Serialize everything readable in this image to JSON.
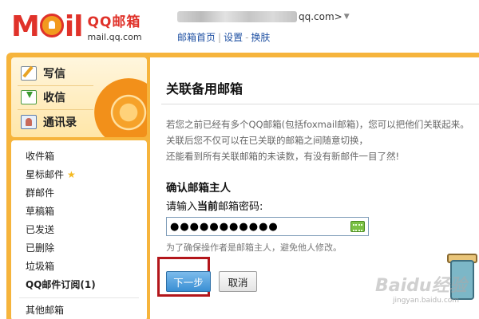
{
  "header": {
    "logo_brand": "Mil",
    "logo_cn": "QQ邮箱",
    "logo_url": "mail.qq.com",
    "account_suffix": "qq.com>",
    "links": [
      "邮箱首页",
      "设置",
      "换肤"
    ],
    "link_separators": [
      "|",
      "-"
    ]
  },
  "sidebar": {
    "quick_actions": [
      "写信",
      "收信",
      "通讯录"
    ],
    "folders": [
      "收件箱",
      "星标邮件",
      "群邮件",
      "草稿箱",
      "已发送",
      "已删除",
      "垃圾箱",
      "QQ邮件订阅(1)",
      "其他邮箱"
    ]
  },
  "main": {
    "title": "关联备用邮箱",
    "intro": [
      "若您之前已经有多个QQ邮箱(包括foxmail邮箱)，您可以把他们关联起来。",
      "关联后您不仅可以在已关联的邮箱之间随意切换，",
      "还能看到所有关联邮箱的未读数，有没有新邮件一目了然!"
    ],
    "confirm_heading": "确认邮箱主人",
    "prompt_prefix": "请输入",
    "prompt_bold": "当前",
    "prompt_suffix": "邮箱密码:",
    "password_value": "●●●●●●●●●●●",
    "hint": "为了确保操作者是邮箱主人，避免他人修改。",
    "next_label": "下一步",
    "cancel_label": "取消"
  },
  "watermark": {
    "text": "Baidu经验",
    "sub": "jingyan.baidu.com"
  },
  "colors": {
    "brand_red": "#e0322a",
    "frame_orange": "#f6b43c",
    "link_blue": "#2152a3",
    "primary_button": "#3a8fd4",
    "highlight_red": "#b3161b"
  }
}
